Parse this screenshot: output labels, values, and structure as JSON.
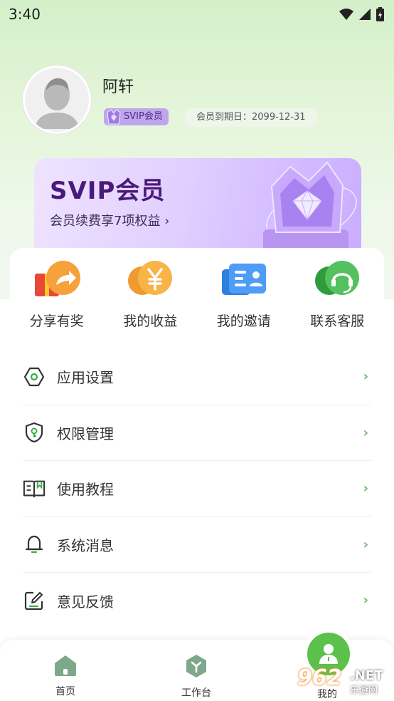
{
  "status_bar": {
    "time": "3:40",
    "icons": [
      "wifi-icon",
      "signal-icon",
      "battery-charging-icon"
    ]
  },
  "profile": {
    "name": "阿轩",
    "membership_badge": "SVIP会员",
    "expire_label": "会员到期日：2099-12-31"
  },
  "svip_card": {
    "title": "SVIP会员",
    "subtitle": "会员续费享7项权益 ›"
  },
  "quick_actions": [
    {
      "label": "分享有奖",
      "icon": "gift-share-icon"
    },
    {
      "label": "我的收益",
      "icon": "yen-coin-icon"
    },
    {
      "label": "我的邀请",
      "icon": "contact-card-icon"
    },
    {
      "label": "联系客服",
      "icon": "headset-icon"
    }
  ],
  "menu": [
    {
      "label": "应用设置",
      "icon": "settings-hexagon-icon"
    },
    {
      "label": "权限管理",
      "icon": "shield-key-icon"
    },
    {
      "label": "使用教程",
      "icon": "book-icon"
    },
    {
      "label": "系统消息",
      "icon": "bell-icon"
    },
    {
      "label": "意见反馈",
      "icon": "edit-note-icon"
    }
  ],
  "menu_chevron": "›",
  "tabbar": {
    "tabs": [
      {
        "label": "首页",
        "icon": "home-icon"
      },
      {
        "label": "工作台",
        "icon": "workbench-icon"
      },
      {
        "label": "我的",
        "icon": "user-icon",
        "active": true
      }
    ]
  },
  "watermark": {
    "number": "962",
    "suffix": ".NET",
    "site": "乐游网"
  },
  "colors": {
    "accent_green": "#5cc14a",
    "svip_purple": "#4a1a7a",
    "chevron_green": "#6fb26a"
  }
}
